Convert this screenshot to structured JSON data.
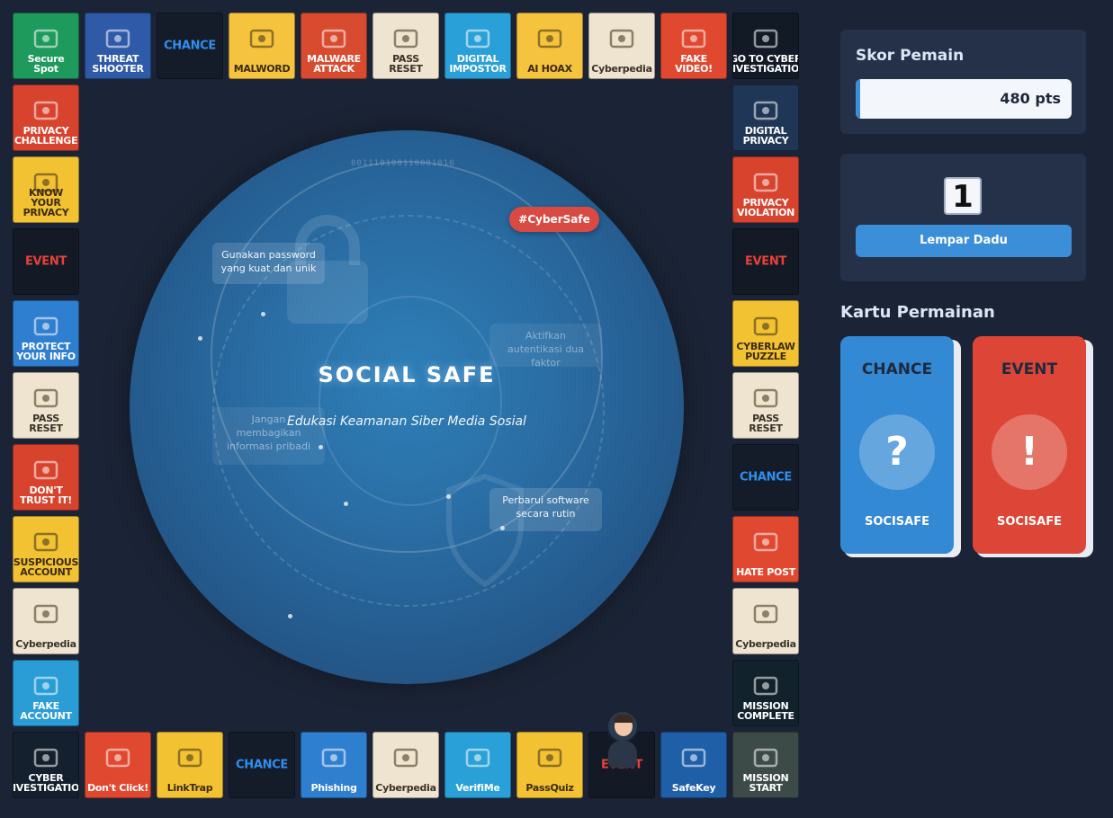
{
  "board": {
    "tiles": [
      {
        "label": "Secure Spot",
        "bg": "#1e9a5c",
        "icon": "shield-icon"
      },
      {
        "label": "THREAT SHOOTER",
        "bg": "#2f5aa8",
        "icon": "crosshair-icon"
      },
      {
        "label": "CHANCE",
        "bg": "#141c2a",
        "icon": "question-icon"
      },
      {
        "label": "MALWORD",
        "bg": "#f5c33d",
        "icon": "computer-icon"
      },
      {
        "label": "MALWARE ATTACK",
        "bg": "#d84b2f",
        "icon": "warning-icon"
      },
      {
        "label": "PASS RESET",
        "bg": "#efe4cf",
        "icon": "laptop-lock-icon"
      },
      {
        "label": "DIGITAL IMPOSTOR",
        "bg": "#2aa0d8",
        "icon": "mask-icon"
      },
      {
        "label": "AI HOAX",
        "bg": "#f5c33d",
        "icon": "fake-icon"
      },
      {
        "label": "Cyberpedia",
        "bg": "#efe4cf",
        "icon": "book-icon"
      },
      {
        "label": "FAKE VIDEO!",
        "bg": "#e0482f",
        "icon": "video-icon"
      },
      {
        "label": "GO TO CYBER INVESTIGATION",
        "bg": "#121a26",
        "icon": "arrow-left-icon"
      },
      {
        "label": "PRIVACY CHALLENGE",
        "bg": "#d8432d",
        "icon": "lock-icon"
      },
      {
        "label": "DIGITAL PRIVACY",
        "bg": "#1f3656",
        "icon": "lock-icon"
      },
      {
        "label": "KNOW YOUR PRIVACY",
        "bg": "#f2c233",
        "icon": "question-icon"
      },
      {
        "label": "PRIVACY VIOLATION",
        "bg": "#d8432d",
        "icon": "scale-icon"
      },
      {
        "label": "EVENT",
        "bg": "#131a26",
        "icon": "alert-icon"
      },
      {
        "label": "EVENT",
        "bg": "#131a26",
        "icon": "alert-icon"
      },
      {
        "label": "PROTECT YOUR INFO",
        "bg": "#2f7fd0",
        "icon": "shield-icon"
      },
      {
        "label": "CYBERLAW PUZZLE",
        "bg": "#f2c233",
        "icon": "puzzle-icon"
      },
      {
        "label": "PASS RESET",
        "bg": "#efe4cf",
        "icon": "laptop-lock-icon"
      },
      {
        "label": "PASS RESET",
        "bg": "#efe4cf",
        "icon": "laptop-lock-icon"
      },
      {
        "label": "DON'T TRUST IT!",
        "bg": "#d8432d",
        "icon": "user-icon"
      },
      {
        "label": "CHANCE",
        "bg": "#141c2a",
        "icon": "question-icon"
      },
      {
        "label": "SUSPICIOUS ACCOUNT",
        "bg": "#f2c233",
        "icon": "search-user-icon"
      },
      {
        "label": "HATE POST",
        "bg": "#e0482f",
        "icon": "angry-icon"
      },
      {
        "label": "Cyberpedia",
        "bg": "#efe4cf",
        "icon": "book-icon"
      },
      {
        "label": "Cyberpedia",
        "bg": "#efe4cf",
        "icon": "book-icon"
      },
      {
        "label": "FAKE ACCOUNT",
        "bg": "#2a9cd6",
        "icon": "user-icon"
      },
      {
        "label": "MISSION COMPLETE",
        "bg": "#12222c",
        "icon": "flag-icon"
      },
      {
        "label": "CYBER INVESTIGATION",
        "bg": "#14202e",
        "icon": "police-icon"
      },
      {
        "label": "Don't Click!",
        "bg": "#e0482f",
        "icon": "link-icon"
      },
      {
        "label": "LinkTrap",
        "bg": "#f2c233",
        "icon": "link-icon"
      },
      {
        "label": "CHANCE",
        "bg": "#141c2a",
        "icon": "question-icon"
      },
      {
        "label": "Phishing",
        "bg": "#2f7fd0",
        "icon": "mail-icon"
      },
      {
        "label": "Cyberpedia",
        "bg": "#efe4cf",
        "icon": "book-icon"
      },
      {
        "label": "VerifiMe",
        "bg": "#2aa0d8",
        "icon": "check-icon"
      },
      {
        "label": "PassQuiz",
        "bg": "#f2c233",
        "icon": "question-icon"
      },
      {
        "label": "EVENT",
        "bg": "#131a26",
        "icon": "alert-icon"
      },
      {
        "label": "SafeKey",
        "bg": "#1f5fa8",
        "icon": "lock-icon"
      },
      {
        "label": "MISSION START",
        "bg": "#3d4b48",
        "icon": "flag-icon"
      }
    ]
  },
  "center": {
    "title": "SOCIAL SAFE",
    "subtitle": "Edukasi Keamanan Siber Media Sosial",
    "tag": "#CyberSafe",
    "binary_top": "001110100110001010",
    "tips": [
      "Gunakan password yang kuat dan unik",
      "Aktifkan autentikasi dua faktor",
      "Jangan membagikan informasi pribadi",
      "Perbarui software secara rutin"
    ]
  },
  "score": {
    "title": "Skor Pemain",
    "value": "480 pts",
    "progress": 0.02
  },
  "dice": {
    "value": "1",
    "button": "Lempar Dadu"
  },
  "cards_section": {
    "title": "Kartu Permainan",
    "cards": [
      {
        "title": "CHANCE",
        "symbol": "?",
        "footer": "SOCISAFE",
        "color": "#3389d4"
      },
      {
        "title": "EVENT",
        "symbol": "!",
        "footer": "SOCISAFE",
        "color": "#dd4637"
      }
    ]
  }
}
